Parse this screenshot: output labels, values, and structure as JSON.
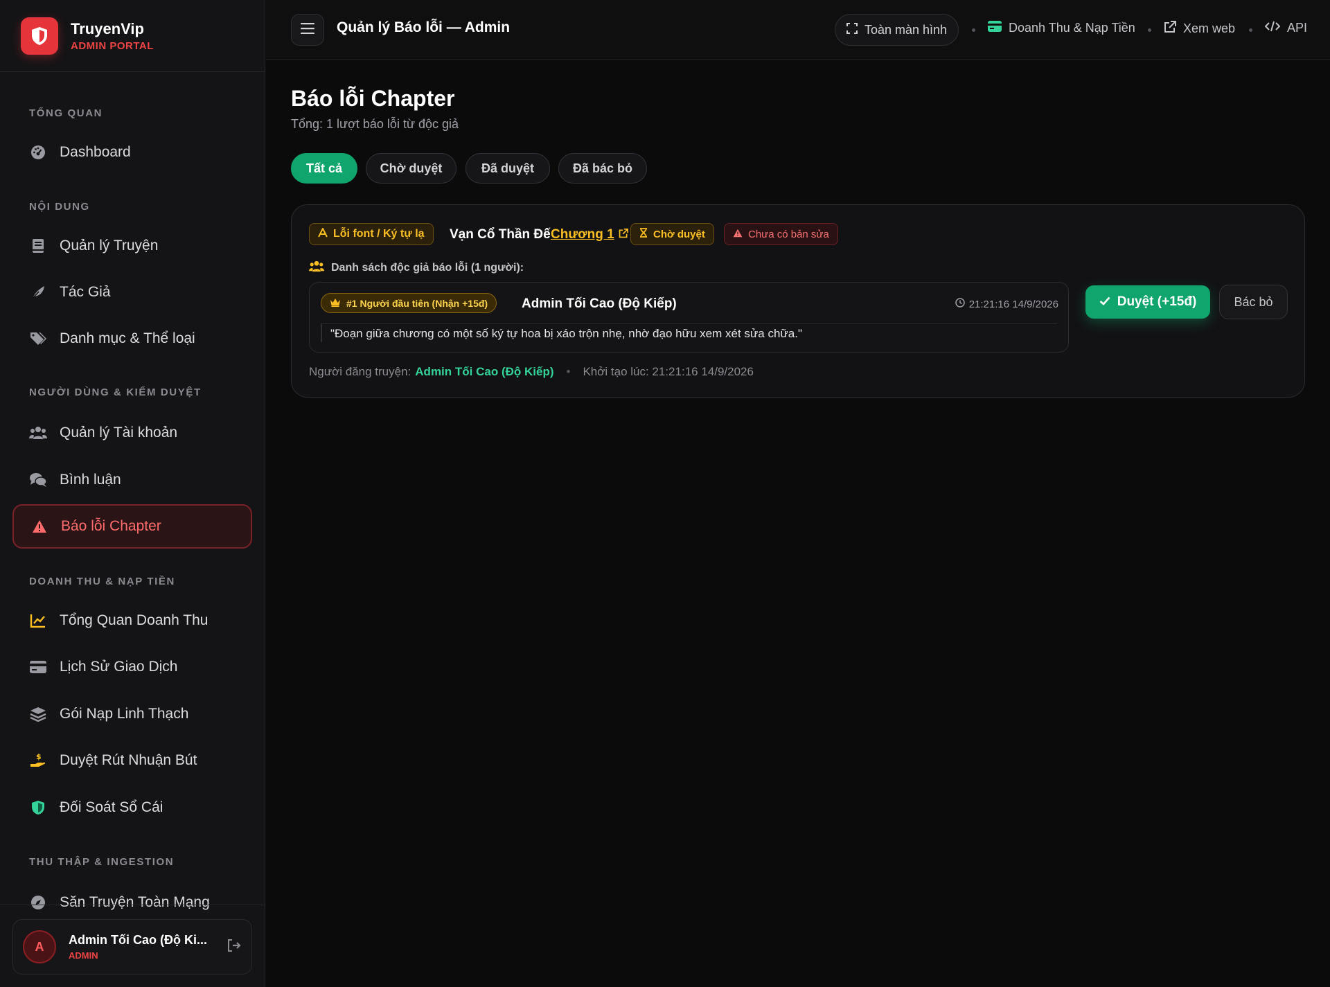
{
  "brand": {
    "name": "TruyenVip",
    "subtitle": "ADMIN PORTAL"
  },
  "sidebar": {
    "sections": [
      {
        "title": "TỔNG QUAN"
      },
      {
        "title": "NỘI DUNG"
      },
      {
        "title": "NGƯỜI DÙNG & KIỂM DUYỆT"
      },
      {
        "title": "DOANH THU & NẠP TIỀN"
      },
      {
        "title": "THU THẬP & INGESTION"
      }
    ],
    "items": [
      {
        "label": "Dashboard",
        "icon": "dashboard-gauge-icon"
      },
      {
        "label": "Quản lý Truyện",
        "icon": "book-icon"
      },
      {
        "label": "Tác Giả",
        "icon": "feather-icon"
      },
      {
        "label": "Danh mục & Thể loại",
        "icon": "tags-icon"
      },
      {
        "label": "Quản lý Tài khoản",
        "icon": "users-icon"
      },
      {
        "label": "Bình luận",
        "icon": "comments-icon"
      },
      {
        "label": "Báo lỗi Chapter",
        "icon": "warning-icon",
        "active": true
      },
      {
        "label": "Tổng Quan Doanh Thu",
        "icon": "chart-line-icon"
      },
      {
        "label": "Lịch Sử Giao Dịch",
        "icon": "credit-card-icon"
      },
      {
        "label": "Gói Nạp Linh Thạch",
        "icon": "layers-icon"
      },
      {
        "label": "Duyệt Rút Nhuận Bút",
        "icon": "hand-coin-icon"
      },
      {
        "label": "Đối Soát Sổ Cái",
        "icon": "shield-icon"
      },
      {
        "label": "Săn Truyện Toàn Mạng",
        "icon": "compass-icon"
      }
    ],
    "user": {
      "initial": "A",
      "name": "Admin Tối Cao (Độ Ki...",
      "role": "ADMIN"
    }
  },
  "topbar": {
    "title": "Quản lý Báo lỗi — Admin",
    "fullscreen_label": "Toàn màn hình",
    "links": [
      "Doanh Thu & Nạp Tiền",
      "Xem web",
      "API"
    ]
  },
  "main": {
    "title": "Báo lỗi Chapter",
    "subtitle": "Tổng: 1 lượt báo lỗi từ độc giả",
    "tabs": [
      "Tất cả",
      "Chờ duyệt",
      "Đã duyệt",
      "Đã bác bỏ"
    ],
    "active_tab": "Tất cả"
  },
  "report": {
    "error_type": "Lỗi font / Ký tự lạ",
    "story": "Vạn Cổ Thần Đế",
    "chapter": "Chương 1",
    "status": "Chờ duyệt",
    "fix_status": "Chưa có bản sửa",
    "reporters_label": "Danh sách độc giả báo lỗi (1 người):",
    "reporters": [
      {
        "badge": "#1 Người đầu tiên (Nhận +15đ)",
        "name": "Admin Tối Cao (Độ Kiếp)",
        "time": "21:21:16 14/9/2026",
        "message": "\"Đoạn giữa chương có một số ký tự hoa bị xáo trộn nhẹ, nhờ đạo hữu xem xét sửa chữa.\""
      }
    ],
    "approve_label": "Duyệt (+15đ)",
    "reject_label": "Bác bỏ",
    "uploader_label": "Người đăng truyện:",
    "uploader": "Admin Tối Cao (Độ Kiếp)",
    "created_label": "Khởi tạo lúc: 21:21:16 14/9/2026"
  },
  "colors": {
    "accent_green": "#10a56d",
    "danger_red": "#ef4444",
    "warning_yellow": "#fbbf24",
    "background": "#0b0b0c"
  }
}
